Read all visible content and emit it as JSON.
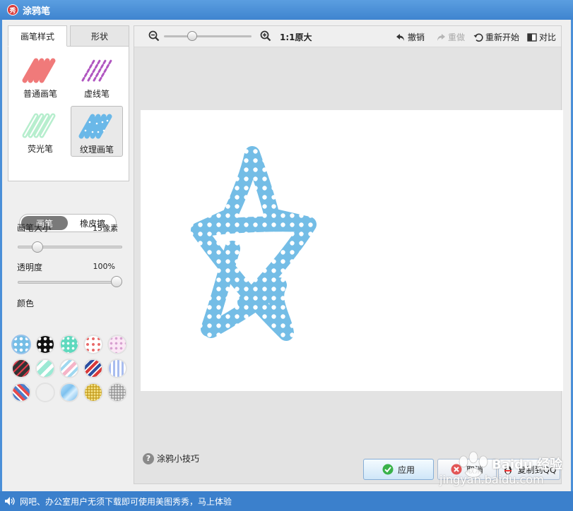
{
  "window": {
    "title": "涂鸦笔",
    "logo_text": "秀"
  },
  "left_panel": {
    "tabs": [
      {
        "label": "画笔样式",
        "active": true
      },
      {
        "label": "形状",
        "active": false
      }
    ],
    "brushes": [
      {
        "label": "普通画笔",
        "color": "#f07a7a"
      },
      {
        "label": "虚线笔",
        "color": "#b056c0"
      },
      {
        "label": "荧光笔",
        "color": "#7be0a6"
      },
      {
        "label": "纹理画笔",
        "color": "#6ab8e8",
        "selected": true
      }
    ],
    "mode": {
      "pen_label": "画笔",
      "eraser_label": "橡皮擦",
      "active": "pen"
    },
    "size": {
      "label": "画笔大小",
      "value": "15像素",
      "fraction": 0.15
    },
    "opacity": {
      "label": "透明度",
      "value": "100%",
      "fraction": 1.0
    },
    "color_label": "颜色",
    "swatches": [
      "blue-dots",
      "black-dots",
      "mint-dots",
      "confetti",
      "pink-stars",
      "dark-red-dashes",
      "mint-stripe",
      "pink-stripe",
      "red-blue-stripe",
      "blue-check",
      "plaid",
      "grid",
      "blue-crystal",
      "gold-glitter",
      "silver-glitter"
    ]
  },
  "toolbar": {
    "zoom_out_icon": "zoom-out-icon",
    "zoom_in_icon": "zoom-in-icon",
    "zoom_fraction": 0.3,
    "actual_size_label": "1:1原大",
    "undo_label": "撤销",
    "redo_label": "重做",
    "restart_label": "重新开始",
    "compare_label": "对比"
  },
  "canvas": {
    "stroke_color": "#74bde6",
    "dot_color": "#ffffff"
  },
  "footer": {
    "tips_label": "涂鸦小技巧",
    "apply_label": "应用",
    "cancel_label": "取消",
    "copy_label": "复制到QQ"
  },
  "status_bar": {
    "text": "网吧、办公室用户无须下载即可使用美图秀秀，马上体验"
  },
  "watermark": {
    "site": "jingyan.baidu.com",
    "brand": "Baidu 经验"
  }
}
